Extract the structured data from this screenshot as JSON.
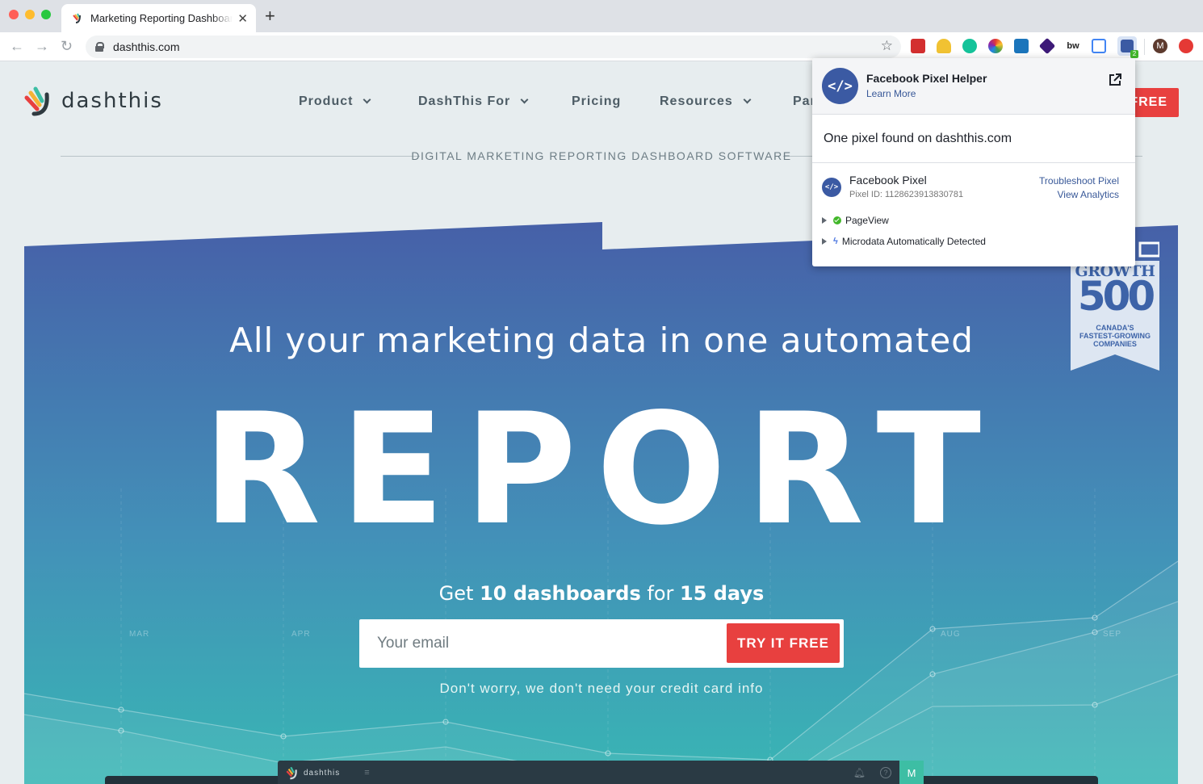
{
  "browser": {
    "tab_title": "Marketing Reporting Dashboard Software | DashThis",
    "new_tab": "+",
    "close_tab": "✕",
    "url": "dashthis.com",
    "profile_initial": "M"
  },
  "site": {
    "logo_text": "dashthis",
    "nav": [
      {
        "label": "Product",
        "dropdown": true
      },
      {
        "label": "DashThis For",
        "dropdown": true
      },
      {
        "label": "Pricing",
        "dropdown": false
      },
      {
        "label": "Resources",
        "dropdown": true
      },
      {
        "label": "Par",
        "dropdown": false
      }
    ],
    "cta_top": "FREE",
    "tagline": "DIGITAL MARKETING REPORTING DASHBOARD SOFTWARE",
    "headline": "All your marketing data in one automated",
    "big_word": "REPORT",
    "offer_pre": "Get ",
    "offer_b1": "10 dashboards",
    "offer_mid": " for ",
    "offer_b2": "15 days",
    "email_placeholder": "Your email",
    "try_button": "TRY IT FREE",
    "note": "Don't worry, we don't need your credit card info",
    "months": [
      "MAR",
      "APR",
      "AUG",
      "SEP"
    ],
    "badge": {
      "line1": "GROWTH",
      "line2": "500",
      "line3": "CANADA'S",
      "line4": "FASTEST-GROWING",
      "line5": "COMPANIES"
    },
    "preview_logo": "dashthis",
    "preview_avatar": "M"
  },
  "popup": {
    "title": "Facebook Pixel Helper",
    "learn_more": "Learn More",
    "found": "One pixel found on dashthis.com",
    "pixel_name": "Facebook Pixel",
    "pixel_id": "Pixel ID: 1128623913830781",
    "troubleshoot": "Troubleshoot Pixel",
    "analytics": "View Analytics",
    "events": [
      "PageView",
      "Microdata Automatically Detected"
    ],
    "icon_glyph": "</>"
  },
  "colors": {
    "brand_red": "#e8403f",
    "hero_top": "#4660a8",
    "hero_bottom": "#3ab8b5",
    "fb_blue": "#3b5aa3"
  }
}
